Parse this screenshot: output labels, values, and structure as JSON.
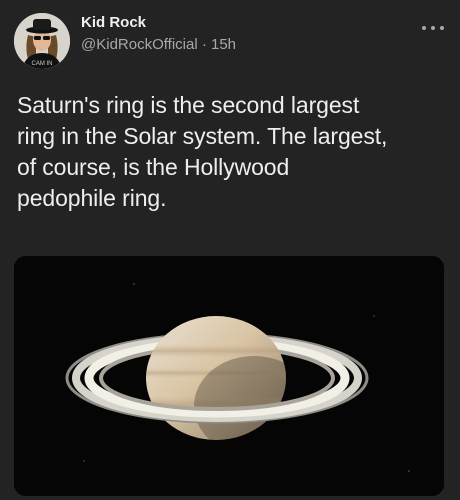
{
  "author": {
    "display_name": "Kid Rock",
    "handle": "@KidRockOfficial",
    "separator": "·",
    "time_ago": "15h",
    "avatar_icon": "avatar-photo",
    "avatar_shirt_text": "CAM IN"
  },
  "post": {
    "text": "Saturn's ring is the second largest\nring in the Solar system. The largest,\nof course, is the Hollywood\npedophile ring.",
    "media_icon": "saturn-photo"
  },
  "menu": {
    "more_icon": "more-horizontal-icon"
  },
  "colors": {
    "background": "#232323",
    "primary_text": "#eeeeee",
    "secondary_text": "#a8a8a8"
  }
}
